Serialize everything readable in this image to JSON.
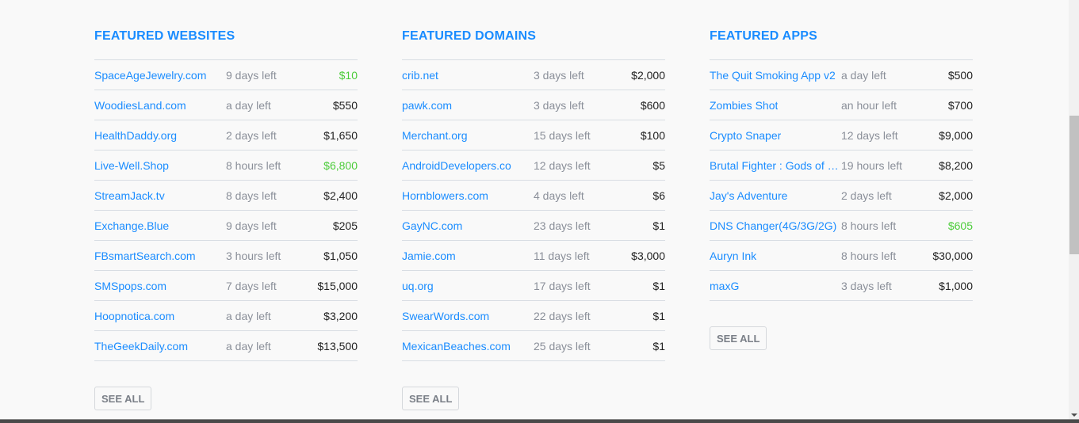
{
  "sections": [
    {
      "title": "FEATURED WEBSITES",
      "see_all": "SEE ALL",
      "items": [
        {
          "name": "SpaceAgeJewelry.com",
          "time": "9 days left",
          "price": "$10",
          "highlight": true
        },
        {
          "name": "WoodiesLand.com",
          "time": "a day left",
          "price": "$550",
          "highlight": false
        },
        {
          "name": "HealthDaddy.org",
          "time": "2 days left",
          "price": "$1,650",
          "highlight": false
        },
        {
          "name": "Live-Well.Shop",
          "time": "8 hours left",
          "price": "$6,800",
          "highlight": true
        },
        {
          "name": "StreamJack.tv",
          "time": "8 days left",
          "price": "$2,400",
          "highlight": false
        },
        {
          "name": "Exchange.Blue",
          "time": "9 days left",
          "price": "$205",
          "highlight": false
        },
        {
          "name": "FBsmartSearch.com",
          "time": "3 hours left",
          "price": "$1,050",
          "highlight": false
        },
        {
          "name": "SMSpops.com",
          "time": "7 days left",
          "price": "$15,000",
          "highlight": false
        },
        {
          "name": "Hoopnotica.com",
          "time": "a day left",
          "price": "$3,200",
          "highlight": false
        },
        {
          "name": "TheGeekDaily.com",
          "time": "a day left",
          "price": "$13,500",
          "highlight": false
        }
      ]
    },
    {
      "title": "FEATURED DOMAINS",
      "see_all": "SEE ALL",
      "items": [
        {
          "name": "crib.net",
          "time": "3 days left",
          "price": "$2,000",
          "highlight": false
        },
        {
          "name": "pawk.com",
          "time": "3 days left",
          "price": "$600",
          "highlight": false
        },
        {
          "name": "Merchant.org",
          "time": "15 days left",
          "price": "$100",
          "highlight": false
        },
        {
          "name": "AndroidDevelopers.co",
          "time": "12 days left",
          "price": "$5",
          "highlight": false
        },
        {
          "name": "Hornblowers.com",
          "time": "4 days left",
          "price": "$6",
          "highlight": false
        },
        {
          "name": "GayNC.com",
          "time": "23 days left",
          "price": "$1",
          "highlight": false
        },
        {
          "name": "Jamie.com",
          "time": "11 days left",
          "price": "$3,000",
          "highlight": false
        },
        {
          "name": "uq.org",
          "time": "17 days left",
          "price": "$1",
          "highlight": false
        },
        {
          "name": "SwearWords.com",
          "time": "22 days left",
          "price": "$1",
          "highlight": false
        },
        {
          "name": "MexicanBeaches.com",
          "time": "25 days left",
          "price": "$1",
          "highlight": false
        }
      ]
    },
    {
      "title": "FEATURED APPS",
      "see_all": "SEE ALL",
      "items": [
        {
          "name": "The Quit Smoking App v2",
          "time": "a day left",
          "price": "$500",
          "highlight": false
        },
        {
          "name": "Zombies Shot",
          "time": "an hour left",
          "price": "$700",
          "highlight": false
        },
        {
          "name": "Crypto Snaper",
          "time": "12 days left",
          "price": "$9,000",
          "highlight": false
        },
        {
          "name": "Brutal Fighter : Gods of War",
          "time": "19 hours left",
          "price": "$8,200",
          "highlight": false
        },
        {
          "name": "Jay's Adventure",
          "time": "2 days left",
          "price": "$2,000",
          "highlight": false
        },
        {
          "name": "DNS Changer(4G/3G/2G)",
          "time": "8 hours left",
          "price": "$605",
          "highlight": true
        },
        {
          "name": "Auryn Ink",
          "time": "8 hours left",
          "price": "$30,000",
          "highlight": false
        },
        {
          "name": "maxG",
          "time": "3 days left",
          "price": "$1,000",
          "highlight": false
        }
      ]
    }
  ]
}
